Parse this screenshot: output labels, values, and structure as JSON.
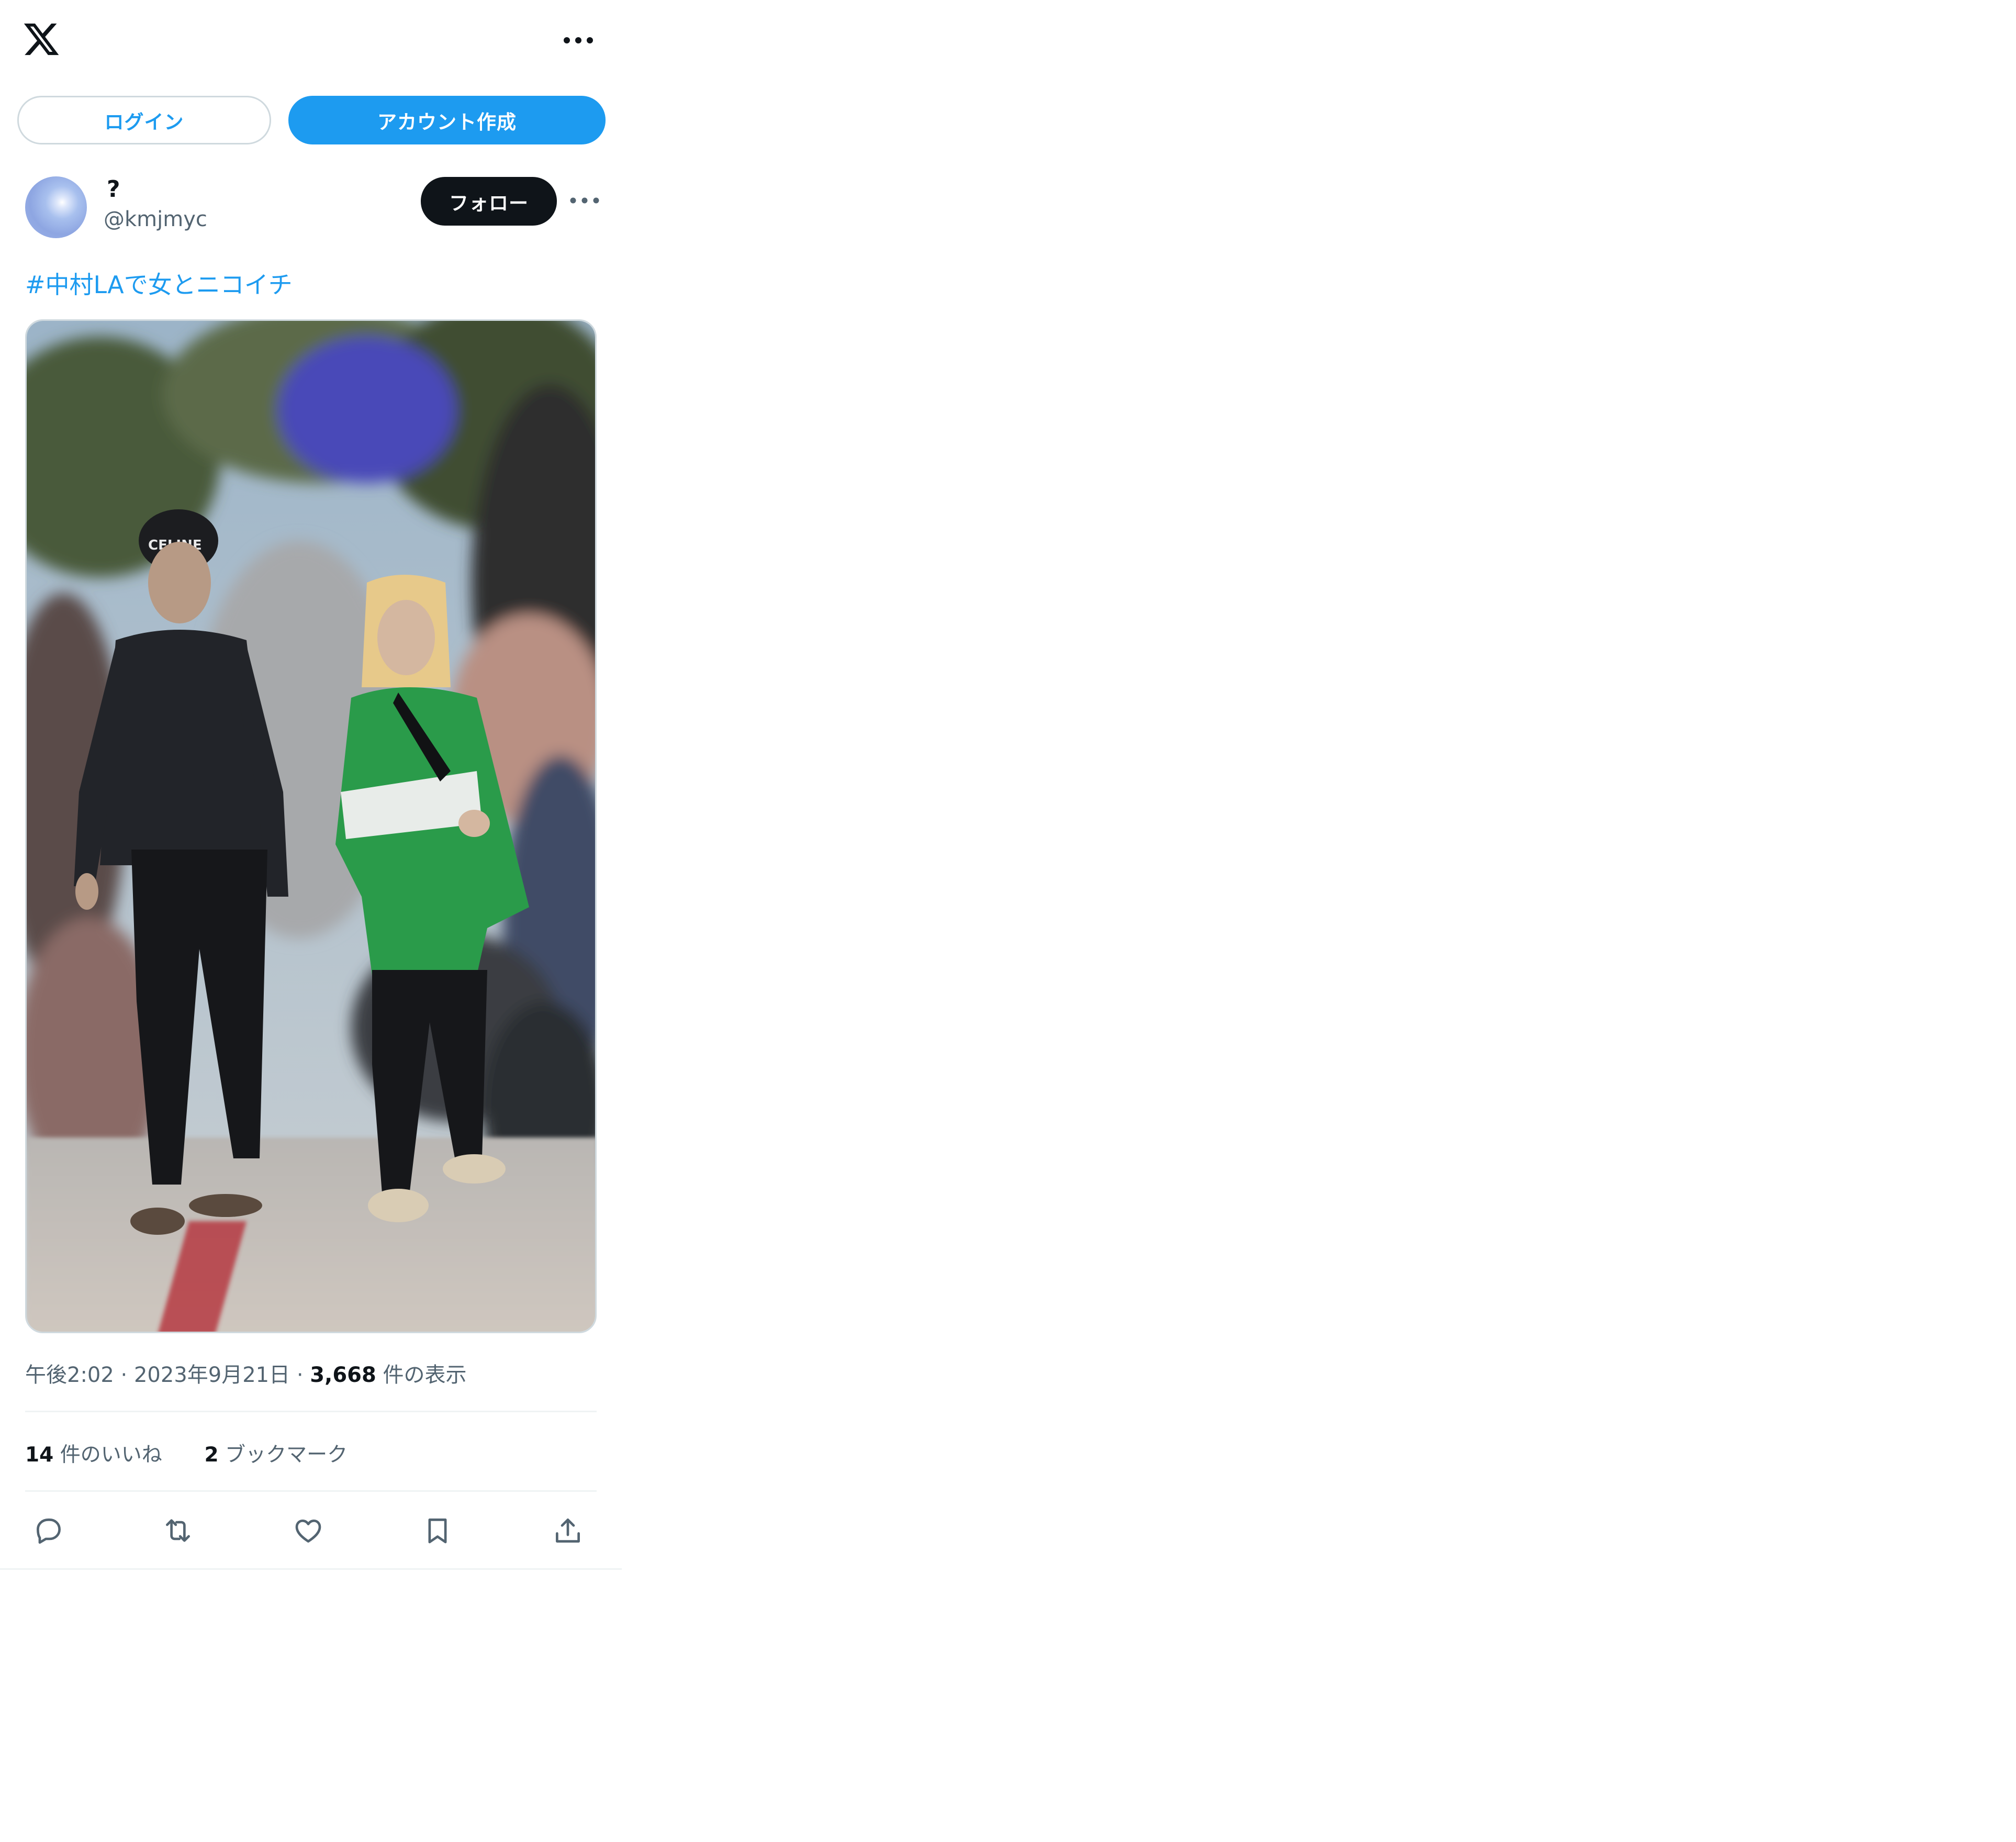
{
  "header": {
    "logo_icon": "x-logo-icon",
    "more_icon": "more-horizontal-icon"
  },
  "auth": {
    "login_label": "ログイン",
    "signup_label": "アカウント作成"
  },
  "author": {
    "display_name": "?",
    "handle": "@kmjmyc",
    "follow_label": "フォロー",
    "more_icon": "more-horizontal-icon"
  },
  "tweet": {
    "text": "#中村LAで女とニコイチ",
    "media": {
      "description_icon": "photo",
      "cap_text": "CELINE"
    },
    "time": "午後2:02",
    "date": "2023年9月21日",
    "views_count": "3,668",
    "views_label": "件の表示",
    "likes_count": "14",
    "likes_label": "件のいいね",
    "bookmarks_count": "2",
    "bookmarks_label": "ブックマーク"
  },
  "actions": {
    "reply_icon": "reply-icon",
    "retweet_icon": "retweet-icon",
    "like_icon": "heart-icon",
    "bookmark_icon": "bookmark-icon",
    "share_icon": "share-icon"
  },
  "colors": {
    "accent": "#1d9bf0",
    "text": "#0f1419",
    "secondary": "#536471",
    "border": "#cfd9de"
  }
}
